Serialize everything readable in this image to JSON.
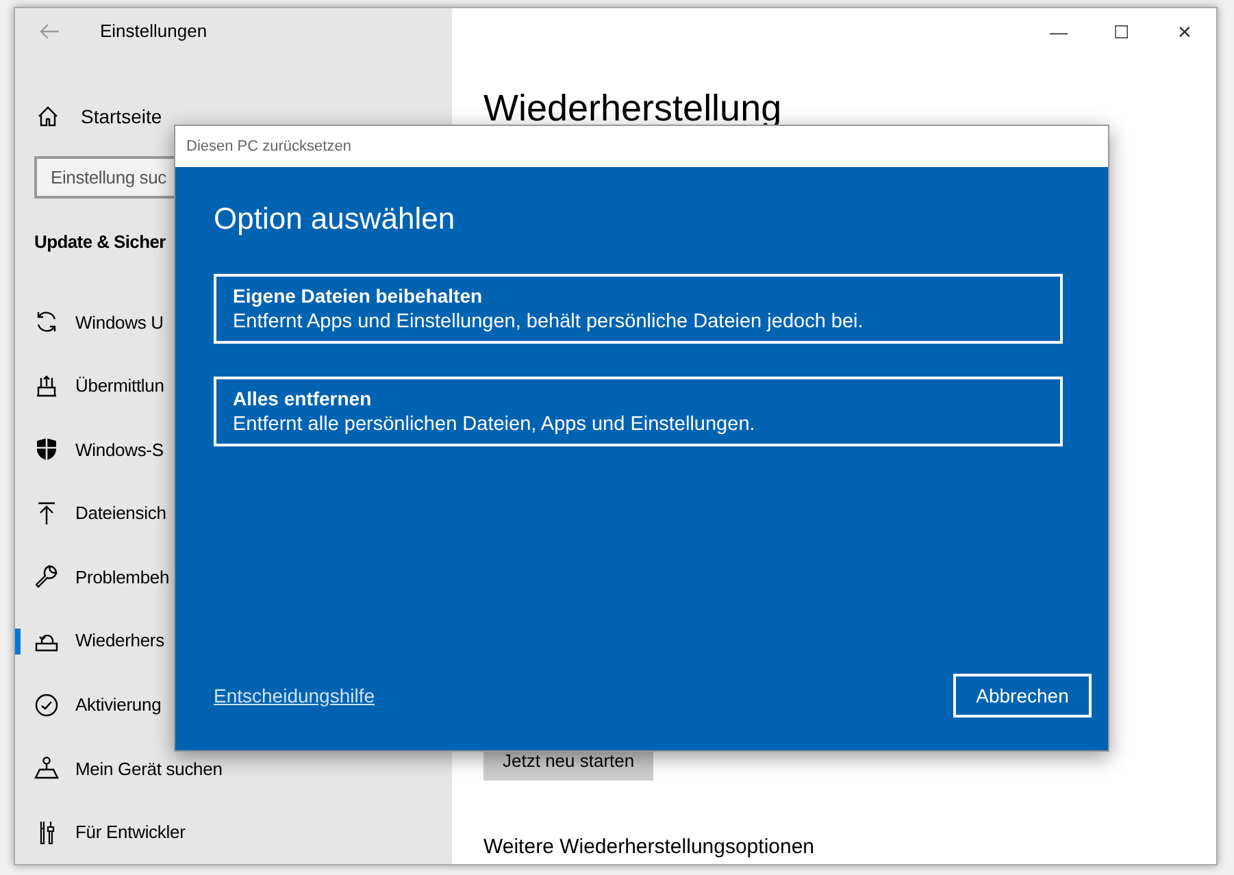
{
  "window": {
    "title": "Einstellungen",
    "controls": [
      "—",
      "☐",
      "✕"
    ]
  },
  "sidebar": {
    "home": "Startseite",
    "search": {
      "placeholder": "Einstellung suc"
    },
    "section": "Update & Sicher",
    "items": [
      {
        "label": "Windows U",
        "selected": false
      },
      {
        "label": "Übermittlun",
        "selected": false
      },
      {
        "label": "Windows-S",
        "selected": false
      },
      {
        "label": "Dateiensich",
        "selected": false
      },
      {
        "label": "Problembeh",
        "selected": false
      },
      {
        "label": "Wiederhers",
        "selected": true
      },
      {
        "label": "Aktivierung",
        "selected": false
      },
      {
        "label": "Mein Gerät suchen",
        "selected": false
      },
      {
        "label": "Für Entwickler",
        "selected": false
      }
    ]
  },
  "main": {
    "heading": "Wiederherstellung",
    "restart_button": "Jetzt neu starten",
    "subheading": "Weitere Wiederherstellungsoptionen"
  },
  "dialog": {
    "title": "Diesen PC zurücksetzen",
    "heading": "Option auswählen",
    "options": [
      {
        "title": "Eigene Dateien beibehalten",
        "description": "Entfernt Apps und Einstellungen, behält persönliche Dateien jedoch bei."
      },
      {
        "title": "Alles entfernen",
        "description": "Entfernt alle persönlichen Dateien, Apps und Einstellungen."
      }
    ],
    "help_link": "Entscheidungshilfe",
    "cancel_button": "Abbrechen"
  }
}
